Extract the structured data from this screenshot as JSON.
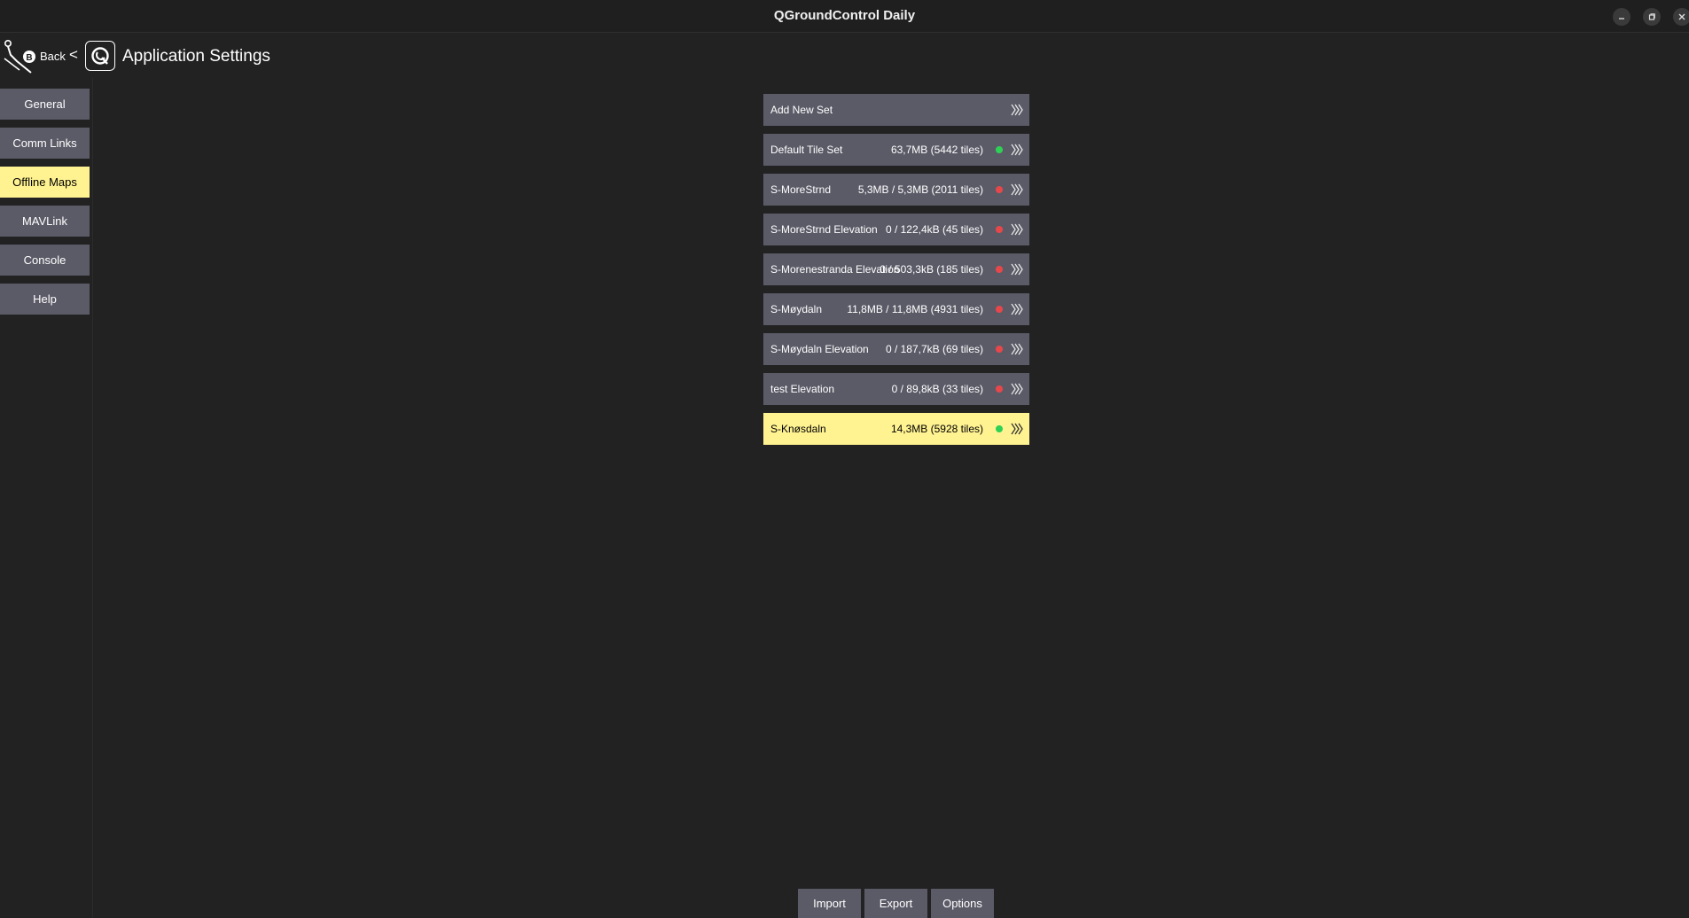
{
  "window": {
    "title": "QGroundControl Daily",
    "controls": [
      "minimize-icon",
      "restore-icon",
      "close-icon"
    ]
  },
  "header": {
    "back_label": "Back",
    "separator": "<",
    "page_title": "Application Settings"
  },
  "sidebar": {
    "items": [
      {
        "label": "General",
        "active": false
      },
      {
        "label": "Comm Links",
        "active": false
      },
      {
        "label": "Offline Maps",
        "active": true
      },
      {
        "label": "MAVLink",
        "active": false
      },
      {
        "label": "Console",
        "active": false
      },
      {
        "label": "Help",
        "active": false
      }
    ]
  },
  "tile_sets": {
    "add_new_label": "Add New Set",
    "items": [
      {
        "name": "Default Tile Set",
        "size": "63,7MB (5442 tiles)",
        "status": "complete"
      },
      {
        "name": "S-MoreStrnd",
        "size": "5,3MB / 5,3MB (2011 tiles)",
        "status": "incomplete"
      },
      {
        "name": "S-MoreStrnd Elevation",
        "size": "0 / 122,4kB (45 tiles)",
        "status": "incomplete"
      },
      {
        "name": "S-Morenestranda Elevation",
        "size": "0 / 503,3kB (185 tiles)",
        "status": "incomplete"
      },
      {
        "name": "S-Møydaln",
        "size": "11,8MB / 11,8MB (4931 tiles)",
        "status": "incomplete"
      },
      {
        "name": "S-Møydaln Elevation",
        "size": "0 / 187,7kB (69 tiles)",
        "status": "incomplete"
      },
      {
        "name": "test Elevation",
        "size": "0 / 89,8kB (33 tiles)",
        "status": "incomplete"
      },
      {
        "name": "S-Knøsdaln",
        "size": "14,3MB (5928 tiles)",
        "status": "complete",
        "selected": true
      }
    ]
  },
  "bottom_buttons": {
    "import_label": "Import",
    "export_label": "Export",
    "options_label": "Options"
  },
  "colors": {
    "background": "#222222",
    "button": "#5b5b68",
    "active": "#fff291",
    "status_complete": "#2ed155",
    "status_incomplete": "#e8474a"
  }
}
